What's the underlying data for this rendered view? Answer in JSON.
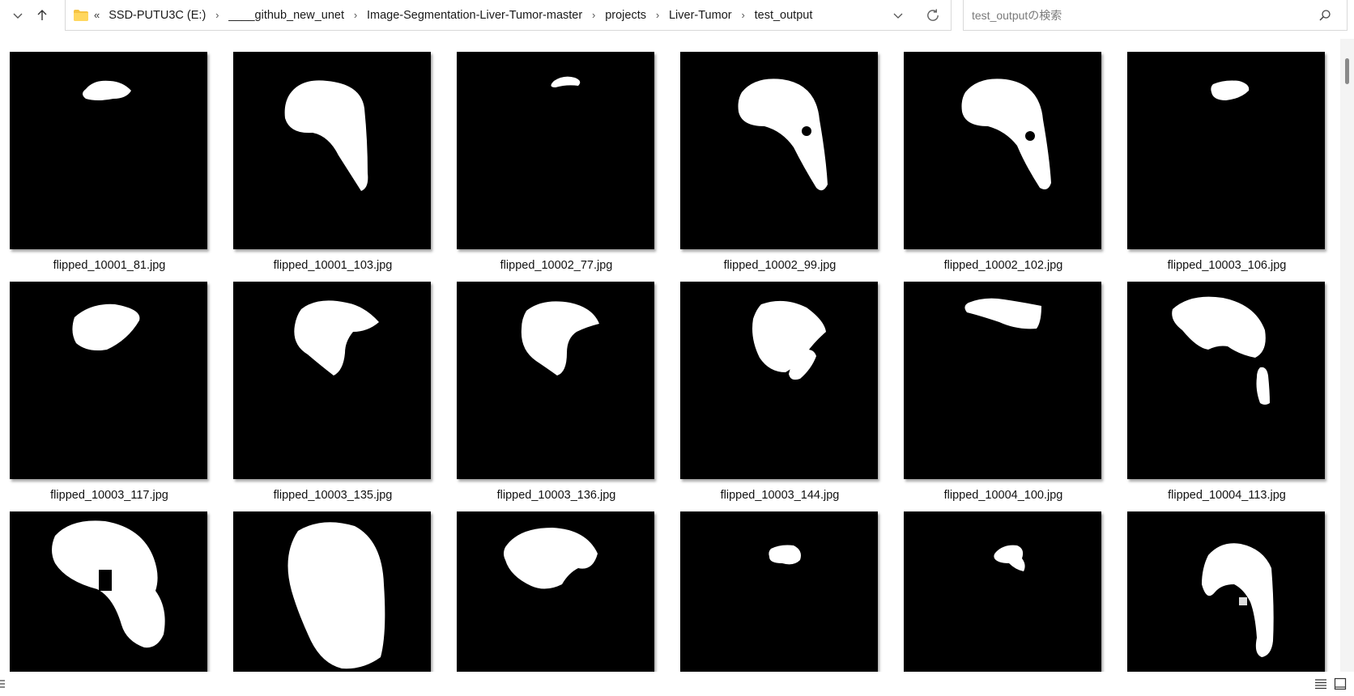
{
  "address": {
    "overflow": "«",
    "crumbs": [
      "SSD-PUTU3C (E:)",
      "____github_new_unet",
      "Image-Segmentation-Liver-Tumor-master",
      "projects",
      "Liver-Tumor",
      "test_output"
    ],
    "separator": "›"
  },
  "search": {
    "placeholder": "test_outputの検索"
  },
  "icons": {
    "chevron-down": "chevron-down-icon",
    "up-arrow": "up-arrow-icon",
    "folder": "folder-icon",
    "refresh": "refresh-icon",
    "search": "search-icon",
    "details-view": "details-view-icon",
    "large-icons-view": "large-icons-view-icon"
  },
  "files": [
    {
      "name": "flipped_10001_81.jpg"
    },
    {
      "name": "flipped_10001_103.jpg"
    },
    {
      "name": "flipped_10002_77.jpg"
    },
    {
      "name": "flipped_10002_99.jpg"
    },
    {
      "name": "flipped_10002_102.jpg"
    },
    {
      "name": "flipped_10003_106.jpg"
    },
    {
      "name": "flipped_10003_117.jpg"
    },
    {
      "name": "flipped_10003_135.jpg"
    },
    {
      "name": "flipped_10003_136.jpg"
    },
    {
      "name": "flipped_10003_144.jpg"
    },
    {
      "name": "flipped_10004_100.jpg"
    },
    {
      "name": "flipped_10004_113.jpg"
    },
    {
      "name": ""
    },
    {
      "name": ""
    },
    {
      "name": ""
    },
    {
      "name": ""
    },
    {
      "name": ""
    },
    {
      "name": ""
    }
  ]
}
